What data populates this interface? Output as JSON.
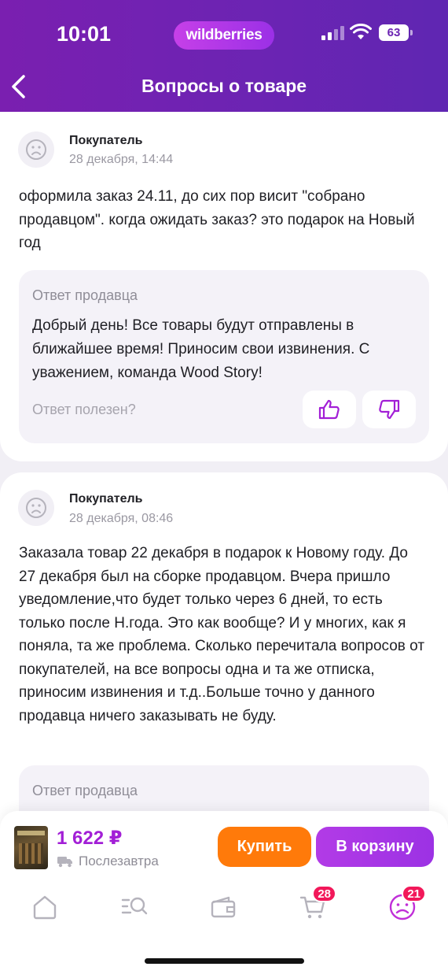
{
  "status_bar": {
    "time": "10:01",
    "brand": "wildberries",
    "battery": "63"
  },
  "header": {
    "title": "Вопросы о товаре"
  },
  "questions": [
    {
      "author": "Покупатель",
      "date": "28 декабря, 14:44",
      "text": "оформила заказ 24.11, до сих пор висит \"собрано продавцом\". когда ожидать заказ? это подарок на Новый год",
      "answer_title": "Ответ продавца",
      "answer_text": "Добрый день! Все товары будут отправлены в ближайшее время! Приносим свои извинения. С уважением, команда Wood Story!",
      "helpful_label": "Ответ полезен?"
    },
    {
      "author": "Покупатель",
      "date": "28 декабря, 08:46",
      "text": "Заказала товар 22 декабря в подарок к Новому году. До 27 декабря был на сборке продавцом. Вчера пришло уведомление,что будет только через 6 дней, то есть только после Н.года. Это как вообще? И у многих, как я поняла, та же проблема. Сколько перечитала вопросов от покупателей, на все вопросы одна и та же отписка, приносим извинения и т.д..Больше точно у данного продавца ничего заказывать не буду.",
      "answer_title": "Ответ продавца"
    }
  ],
  "product_bar": {
    "price": "1 622 ₽",
    "delivery": "Послезавтра",
    "buy_label": "Купить",
    "cart_label": "В корзину"
  },
  "nav": {
    "items": [
      "home-icon",
      "catalog-search-icon",
      "wallet-icon",
      "cart-icon",
      "profile-icon"
    ],
    "cart_badge": "28",
    "profile_badge": "21"
  },
  "colors": {
    "brand_purple": "#6b24b3",
    "accent_purple": "#a21fd6",
    "buy_orange": "#ff7a0a",
    "badge_red": "#f2185a"
  }
}
